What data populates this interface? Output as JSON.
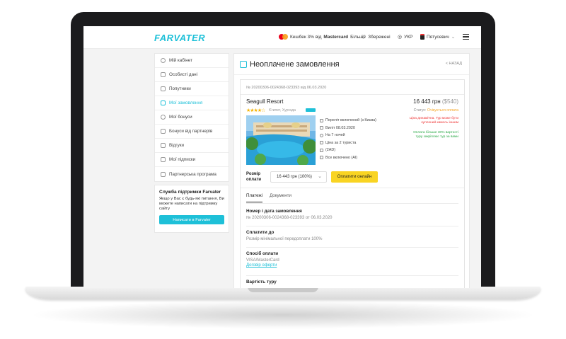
{
  "header": {
    "logo": "FARVATER",
    "cashback_text": "Кешбек 3% від",
    "mastercard_text": "Mastercard",
    "more_text": "Більше",
    "saved": "Збережені",
    "lang": "УКР",
    "user": "Пятусевич"
  },
  "sidebar": {
    "items": [
      {
        "label": "Мій кабінет"
      },
      {
        "label": "Особисті дані"
      },
      {
        "label": "Попутники"
      },
      {
        "label": "Мої замовлення"
      },
      {
        "label": "Мої бонуси"
      },
      {
        "label": "Бонуси від партнерів"
      },
      {
        "label": "Відгуки"
      },
      {
        "label": "Мої підписки"
      },
      {
        "label": "Партнерська програма"
      }
    ],
    "active_index": 3
  },
  "support": {
    "title": "Служба підтримки Farvater",
    "text": "Якщо у Вас є будь-які питання, Ви можете написати на підтримку сайту",
    "button": "Написати в Farvater"
  },
  "main": {
    "title": "Неоплачене замовлення",
    "back": "< НАЗАД",
    "order_number": "№ 20200306-0024368-023393 від 06.03.2020",
    "hotel": "Seagull Resort",
    "stars": "★★★★☆",
    "location": "Єгипет, Хургада",
    "price": "16 443 грн",
    "price_alt": "($540)",
    "status_label": "Статус:",
    "status_value": "Очікується оплата",
    "details": [
      "Переліт включений (з Києва)",
      "Виліт 08.03.2020",
      "На 7 ночей",
      "Ціна за 2 туриста",
      "(2AD)",
      "Все включено (AI)"
    ],
    "note_red": "Ціна динамічна. Тур може бути куплений кимось іншим",
    "note_green": "Оплата більше 30% вартості туру закріплює тур за вами",
    "pay_label": "Розмір оплати",
    "pay_option": "16 443 грн (100%)",
    "pay_button": "Оплатити онлайн",
    "tabs": [
      "Платежі",
      "Документи"
    ],
    "info": [
      {
        "title": "Номер і дата замовлення",
        "value": "№ 20200306-0024368-023393 от 06.03.2020"
      },
      {
        "title": "Сплатити до",
        "value": "Розмір мінімальної передоплати 100%"
      },
      {
        "title": "Спосіб оплати",
        "value": "VISA/MasterCard",
        "link": "Договір оферти"
      },
      {
        "title": "Вартість туру",
        "value": ""
      }
    ]
  }
}
